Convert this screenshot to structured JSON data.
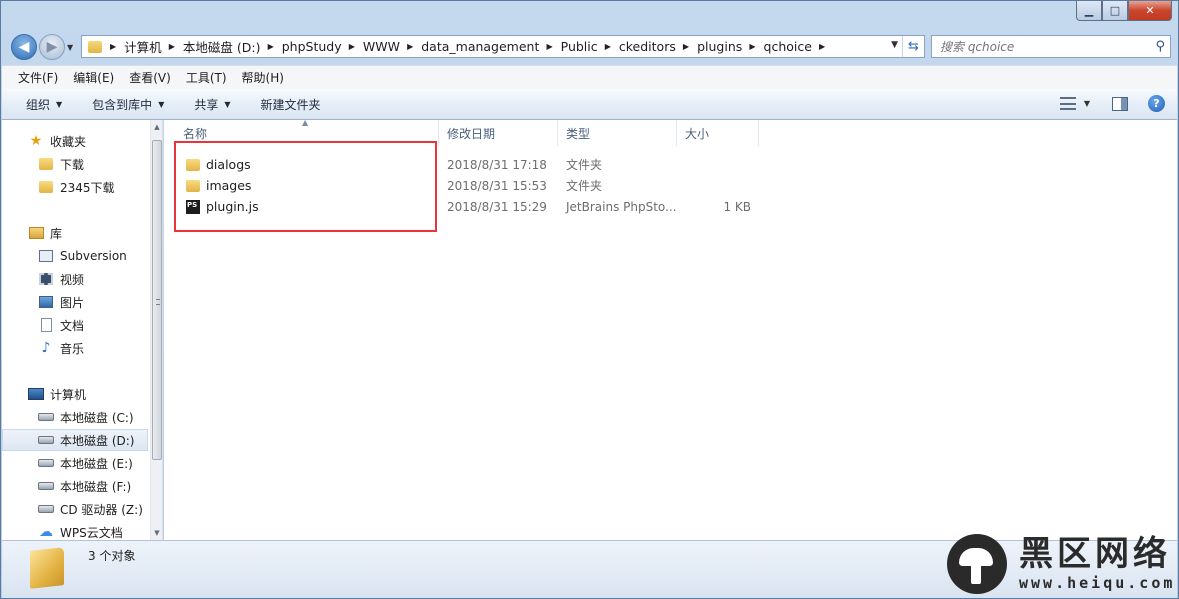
{
  "address_bar": {
    "breadcrumbs": [
      "计算机",
      "本地磁盘 (D:)",
      "phpStudy",
      "WWW",
      "data_management",
      "Public",
      "ckeditors",
      "plugins",
      "qchoice"
    ]
  },
  "search": {
    "placeholder": "搜索 qchoice"
  },
  "menubar": {
    "items": [
      "文件(F)",
      "编辑(E)",
      "查看(V)",
      "工具(T)",
      "帮助(H)"
    ]
  },
  "toolbar": {
    "organize": "组织",
    "include_in_library": "包含到库中",
    "share": "共享",
    "new_folder": "新建文件夹"
  },
  "nav_pane": {
    "favorites": {
      "label": "收藏夹",
      "items": [
        "下载",
        "2345下载"
      ]
    },
    "libraries": {
      "label": "库",
      "items": [
        "Subversion",
        "视频",
        "图片",
        "文档",
        "音乐"
      ]
    },
    "computer": {
      "label": "计算机",
      "items": [
        "本地磁盘 (C:)",
        "本地磁盘 (D:)",
        "本地磁盘 (E:)",
        "本地磁盘 (F:)",
        "CD 驱动器 (Z:)",
        "WPS云文档"
      ],
      "selected": "本地磁盘 (D:)"
    }
  },
  "file_list": {
    "columns": [
      "名称",
      "修改日期",
      "类型",
      "大小"
    ],
    "rows": [
      {
        "name": "dialogs",
        "modified": "2018/8/31 17:18",
        "type": "文件夹",
        "size": "",
        "icon": "folder-icon"
      },
      {
        "name": "images",
        "modified": "2018/8/31 15:53",
        "type": "文件夹",
        "size": "",
        "icon": "folder-icon"
      },
      {
        "name": "plugin.js",
        "modified": "2018/8/31 15:29",
        "type": "JetBrains PhpSto...",
        "size": "1 KB",
        "icon": "phpstorm-file-icon"
      }
    ]
  },
  "status": {
    "count_text": "3 个对象"
  },
  "watermark": {
    "title": "黑区网络",
    "url": "www.heiqu.com"
  },
  "colors": {
    "highlight": "#e8353a",
    "accent": "#2f6cb4"
  }
}
